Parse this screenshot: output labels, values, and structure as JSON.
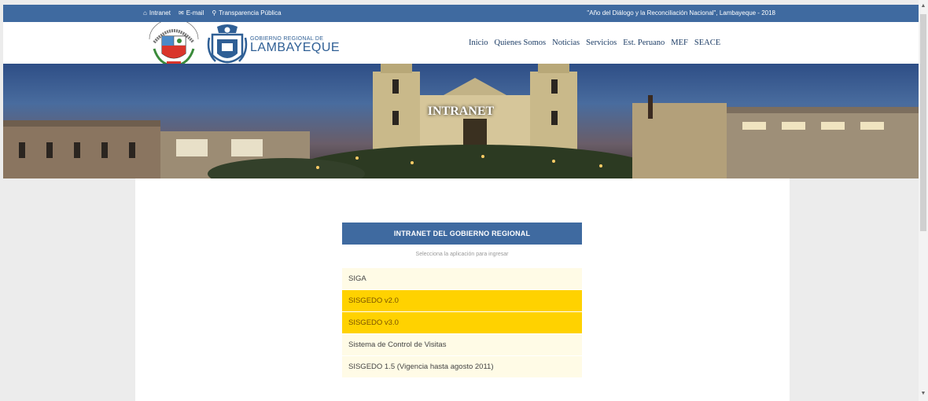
{
  "topbar": {
    "links": [
      {
        "icon": "home-icon",
        "label": "Intranet"
      },
      {
        "icon": "envelope-icon",
        "label": "E-mail"
      },
      {
        "icon": "search-icon",
        "label": "Transparencia Pública"
      }
    ],
    "motto": "\"Año del Diálogo y la Reconciliación Nacional\", Lambayeque - 2018"
  },
  "header": {
    "brand_small": "GOBIERNO REGIONAL DE",
    "brand_big": "LAMBAYEQUE",
    "nav": [
      "Inicio",
      "Quienes Somos",
      "Noticias",
      "Servicios",
      "Est. Peruano",
      "MEF",
      "SEACE"
    ]
  },
  "hero": {
    "title": "INTRANET"
  },
  "intranet": {
    "heading": "INTRANET DEL GOBIERNO REGIONAL",
    "subtitle": "Selecciona la aplicación para ingresar",
    "apps": [
      {
        "label": "SIGA",
        "highlight": false
      },
      {
        "label": "SISGEDO v2.0",
        "highlight": true
      },
      {
        "label": "SISGEDO v3.0",
        "highlight": true
      },
      {
        "label": "Sistema de Control de Visitas",
        "highlight": false
      },
      {
        "label": "SISGEDO 1.5 (Vigencia hasta agosto 2011)",
        "highlight": false
      }
    ]
  },
  "colors": {
    "primary": "#3f6aa0",
    "highlight": "#ffd200",
    "app_bg": "#fffbe6"
  }
}
